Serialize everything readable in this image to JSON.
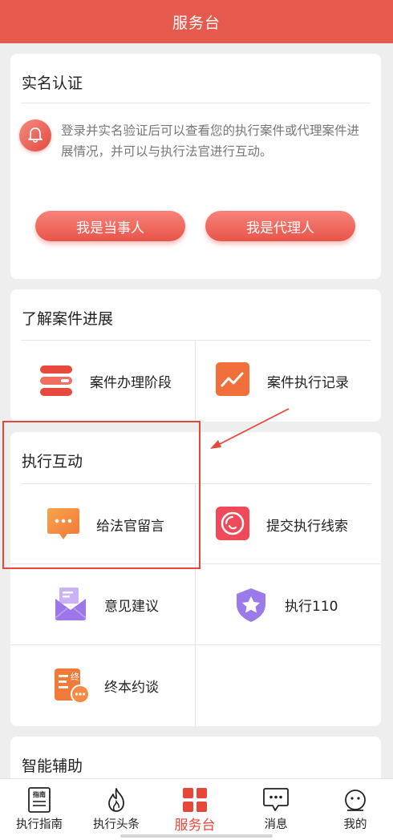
{
  "header": {
    "title": "服务台"
  },
  "auth": {
    "title": "实名认证",
    "description": "登录并实名验证后可以查看您的执行案件或代理案件进展情况，并可以与执行法官进行互动。",
    "btn_party": "我是当事人",
    "btn_agent": "我是代理人"
  },
  "progress": {
    "title": "了解案件进展",
    "items": [
      {
        "label": "案件办理阶段",
        "icon": "stack-layers-icon"
      },
      {
        "label": "案件执行记录",
        "icon": "trend-chart-icon"
      }
    ]
  },
  "interact": {
    "title": "执行互动",
    "items": [
      {
        "label": "给法官留言",
        "icon": "chat-bubble-icon"
      },
      {
        "label": "提交执行线索",
        "icon": "clue-disc-icon"
      },
      {
        "label": "意见建议",
        "icon": "envelope-icon"
      },
      {
        "label": "执行110",
        "icon": "shield-star-icon"
      },
      {
        "label": "终本约谈",
        "icon": "document-chat-icon"
      }
    ]
  },
  "assist": {
    "title": "智能辅助"
  },
  "tabbar": {
    "items": [
      {
        "label": "执行指南",
        "icon": "guide-book-icon",
        "icon_text": "指南"
      },
      {
        "label": "执行头条",
        "icon": "flame-icon"
      },
      {
        "label": "服务台",
        "icon": "grid-icon"
      },
      {
        "label": "消息",
        "icon": "message-icon"
      },
      {
        "label": "我的",
        "icon": "face-icon"
      }
    ],
    "active_index": 2
  },
  "colors": {
    "brand": "#e55a4d",
    "accent_red": "#e5473b",
    "orange": "#f0843d",
    "purple": "#9d7be8"
  }
}
